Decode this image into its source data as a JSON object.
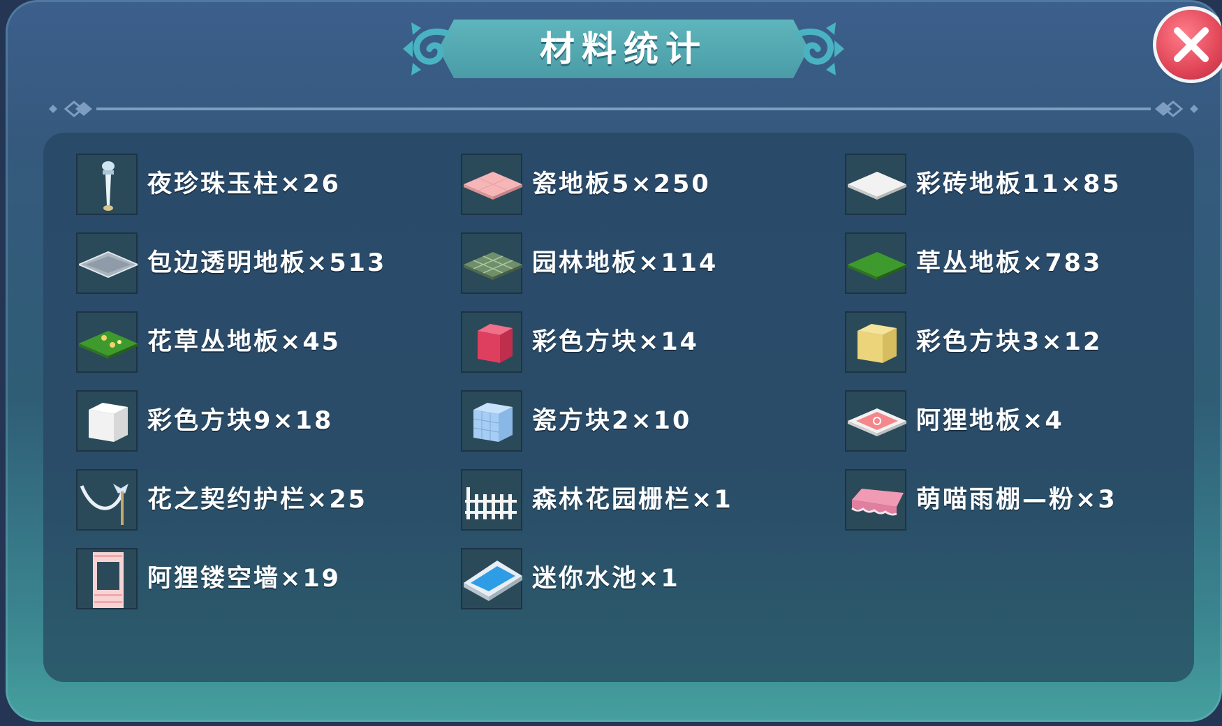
{
  "dialog": {
    "title": "材料统计",
    "close_icon": "close-icon",
    "colors": {
      "accent": "#4fa6ae",
      "close": "#e04557",
      "text": "#ffffff"
    }
  },
  "items": [
    {
      "label": "夜珍珠玉柱×26",
      "icon": "pearl-pillar-icon"
    },
    {
      "label": "瓷地板5×250",
      "icon": "pink-tile-floor-icon"
    },
    {
      "label": "彩砖地板11×85",
      "icon": "white-tile-floor-icon"
    },
    {
      "label": "包边透明地板×513",
      "icon": "glass-floor-icon"
    },
    {
      "label": "园林地板×114",
      "icon": "garden-floor-icon"
    },
    {
      "label": "草丛地板×783",
      "icon": "grass-floor-icon"
    },
    {
      "label": "花草丛地板×45",
      "icon": "flower-grass-floor-icon"
    },
    {
      "label": "彩色方块×14",
      "icon": "red-cube-icon"
    },
    {
      "label": "彩色方块3×12",
      "icon": "yellow-cube-icon"
    },
    {
      "label": "彩色方块9×18",
      "icon": "white-cube-icon"
    },
    {
      "label": "瓷方块2×10",
      "icon": "blue-tile-cube-icon"
    },
    {
      "label": "阿狸地板×4",
      "icon": "ahri-floor-icon"
    },
    {
      "label": "花之契约护栏×25",
      "icon": "ribbon-railing-icon"
    },
    {
      "label": "森林花园栅栏×1",
      "icon": "white-fence-icon"
    },
    {
      "label": "萌喵雨棚—粉×3",
      "icon": "pink-awning-icon"
    },
    {
      "label": "阿狸镂空墙×19",
      "icon": "hollow-wall-icon"
    },
    {
      "label": "迷你水池×1",
      "icon": "mini-pool-icon"
    }
  ]
}
